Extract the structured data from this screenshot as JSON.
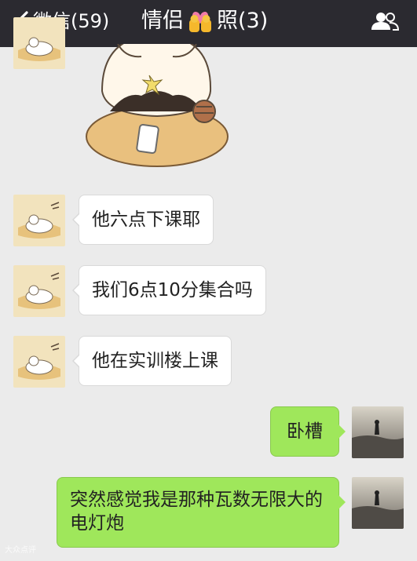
{
  "nav": {
    "back_label": "微信(59)",
    "title_prefix": "情侣",
    "title_suffix": "照(3)"
  },
  "messages": [
    {
      "from": "other",
      "text": "他六点下课耶"
    },
    {
      "from": "other",
      "text": "我们6点10分集合吗"
    },
    {
      "from": "other",
      "text": "他在实训楼上课"
    },
    {
      "from": "me",
      "text": "卧槽"
    },
    {
      "from": "me",
      "text": "突然感觉我是那种瓦数无限大的电灯炮"
    }
  ],
  "watermark": "大众点评",
  "icons": {
    "back": "chevron-left-icon",
    "title_emoji": "couple-heart-emoji",
    "contacts": "group-contacts-icon",
    "sticker": "raccoon-phone-sticker"
  },
  "colors": {
    "nav_bg": "#2b2a30",
    "chat_bg": "#ebebeb",
    "bubble_in": "#ffffff",
    "bubble_out": "#9fe75b"
  }
}
